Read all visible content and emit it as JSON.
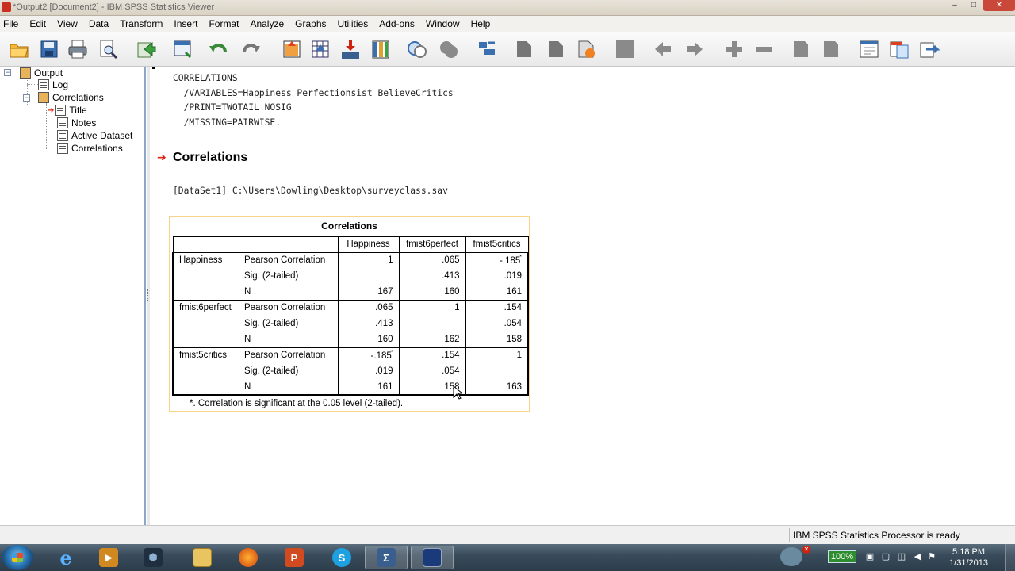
{
  "window": {
    "title": "*Output2 [Document2] - IBM SPSS Statistics Viewer"
  },
  "menu": [
    "File",
    "Edit",
    "View",
    "Data",
    "Transform",
    "Insert",
    "Format",
    "Analyze",
    "Graphs",
    "Utilities",
    "Add-ons",
    "Window",
    "Help"
  ],
  "toolbar": {
    "icons": [
      "open-icon",
      "save-icon",
      "print-icon",
      "print-preview-icon",
      "export-icon",
      "recall-dialog-icon",
      "undo-icon",
      "redo-icon",
      "goto-data-icon",
      "goto-case-icon",
      "goto-variable-icon",
      "variables-icon",
      "select-output-icon",
      "show-icon",
      "hide-icon",
      "expand-icon",
      "promote-icon",
      "demote-icon",
      "insert-heading-icon",
      "insert-title-icon",
      "insert-text-icon",
      "back-icon",
      "forward-icon",
      "add-icon",
      "remove-icon",
      "collapse-icon",
      "expand-all-icon",
      "designate-window-icon",
      "copy-icon",
      "paste-icon"
    ]
  },
  "tree": {
    "root": "Output",
    "log": "Log",
    "correlations": "Correlations",
    "title": "Title",
    "notes": "Notes",
    "active_dataset": "Active Dataset",
    "correlations_table": "Correlations"
  },
  "syntax": {
    "line1": "CORRELATIONS",
    "line2": "  /VARIABLES=Happiness Perfectionsist BelieveCritics",
    "line3": "  /PRINT=TWOTAIL NOSIG",
    "line4": "  /MISSING=PAIRWISE."
  },
  "section_title": "Correlations",
  "dataset": "[DataSet1] C:\\Users\\Dowling\\Desktop\\surveyclass.sav",
  "table": {
    "title": "Correlations",
    "columns": [
      "Happiness",
      "fmist6perfect",
      "fmist5critics"
    ],
    "groups": [
      {
        "label": "Happiness",
        "rows": [
          {
            "stat": "Pearson Correlation",
            "v": [
              "1",
              ".065",
              "-.185"
            ],
            "sig_mark": [
              false,
              false,
              true
            ]
          },
          {
            "stat": "Sig. (2-tailed)",
            "v": [
              "",
              ".413",
              ".019"
            ],
            "sig_mark": [
              false,
              false,
              false
            ]
          },
          {
            "stat": "N",
            "v": [
              "167",
              "160",
              "161"
            ],
            "sig_mark": [
              false,
              false,
              false
            ]
          }
        ]
      },
      {
        "label": "fmist6perfect",
        "rows": [
          {
            "stat": "Pearson Correlation",
            "v": [
              ".065",
              "1",
              ".154"
            ],
            "sig_mark": [
              false,
              false,
              false
            ]
          },
          {
            "stat": "Sig. (2-tailed)",
            "v": [
              ".413",
              "",
              ".054"
            ],
            "sig_mark": [
              false,
              false,
              false
            ]
          },
          {
            "stat": "N",
            "v": [
              "160",
              "162",
              "158"
            ],
            "sig_mark": [
              false,
              false,
              false
            ]
          }
        ]
      },
      {
        "label": "fmist5critics",
        "rows": [
          {
            "stat": "Pearson Correlation",
            "v": [
              "-.185",
              ".154",
              "1"
            ],
            "sig_mark": [
              true,
              false,
              false
            ]
          },
          {
            "stat": "Sig. (2-tailed)",
            "v": [
              ".019",
              ".054",
              ""
            ],
            "sig_mark": [
              false,
              false,
              false
            ]
          },
          {
            "stat": "N",
            "v": [
              "161",
              "158",
              "163"
            ],
            "sig_mark": [
              false,
              false,
              false
            ]
          }
        ]
      }
    ],
    "sig_symbol": "*",
    "footnote": "*. Correlation is significant at the 0.05 level (2-tailed)."
  },
  "status": {
    "processor": "IBM SPSS Statistics Processor is ready"
  },
  "taskbar": {
    "apps": [
      "internet-explorer-icon",
      "media-player-icon",
      "apps-icon",
      "file-explorer-icon",
      "firefox-icon",
      "powerpoint-icon",
      "skype-icon",
      "spss-statistics-icon",
      "spss-viewer-icon"
    ],
    "battery": "100%",
    "time": "5:18 PM",
    "date": "1/31/2013"
  },
  "colors": {
    "accent_red": "#e02010",
    "frame_highlight": "#f8d488",
    "tree_border": "#8aa6c8"
  }
}
